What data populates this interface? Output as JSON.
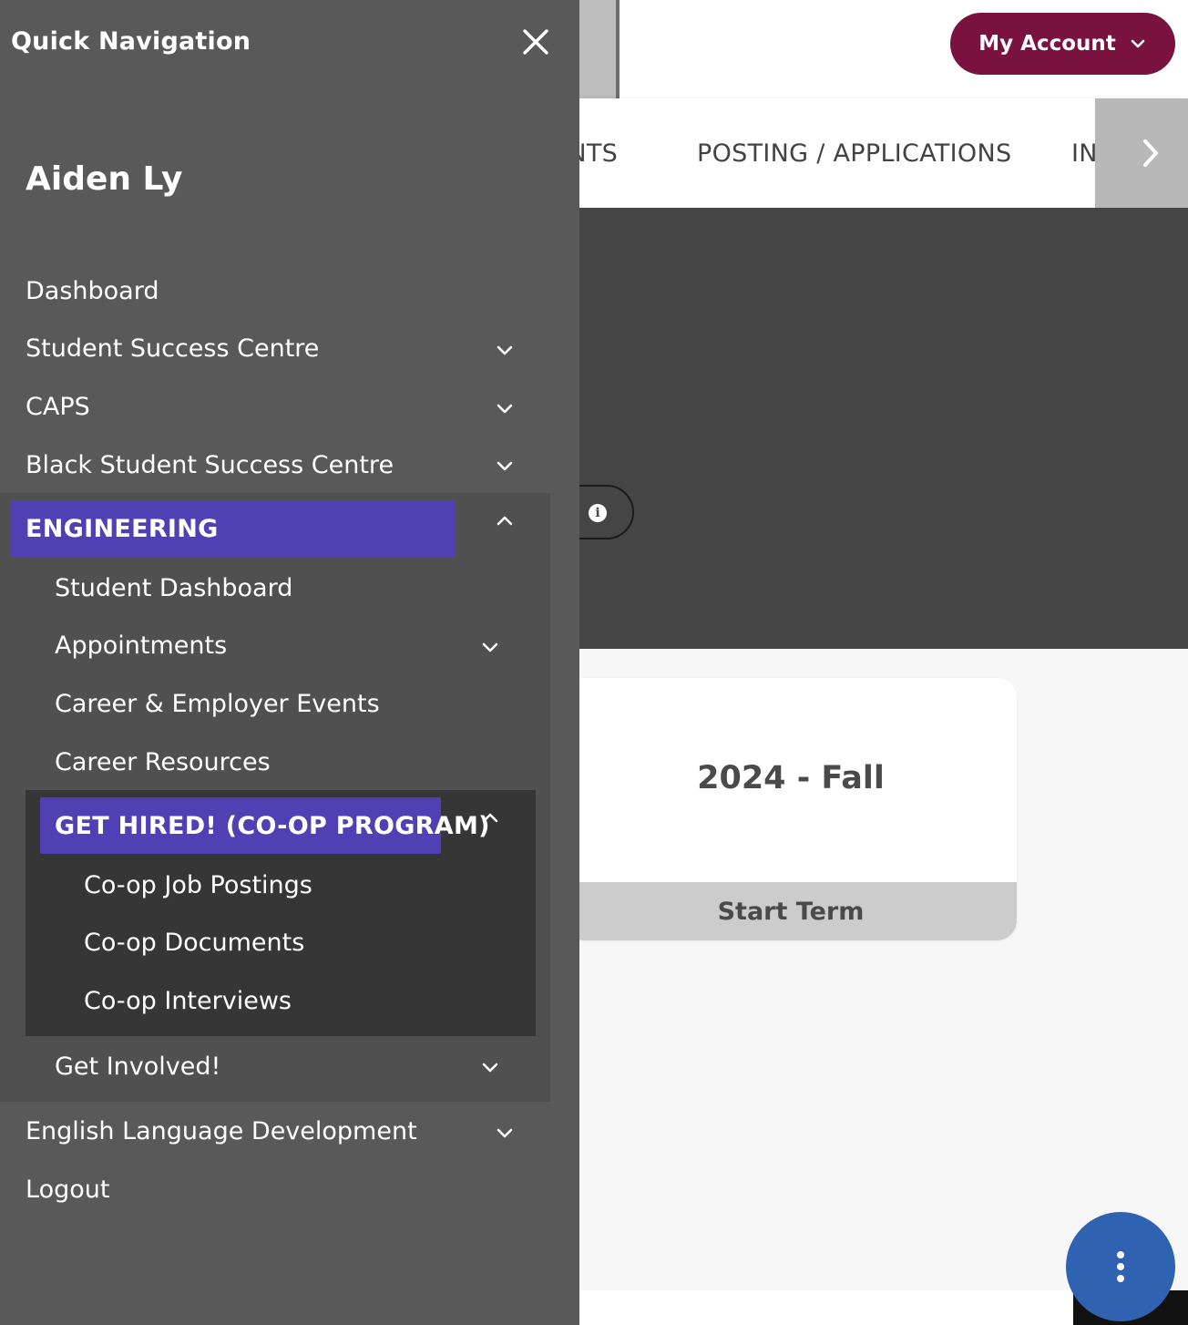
{
  "header": {
    "account_label": "My Account"
  },
  "tabs": {
    "items": [
      {
        "label": "ENTS"
      },
      {
        "label": "POSTING / APPLICATIONS"
      },
      {
        "label": "INTER"
      }
    ]
  },
  "term_card": {
    "title": "2024 - Fall",
    "button_label": "Start Term"
  },
  "drawer": {
    "title": "Quick Navigation",
    "user_name": "Aiden Ly",
    "items": {
      "dashboard": "Dashboard",
      "student_success": "Student Success Centre",
      "caps": "CAPS",
      "black_student": "Black Student Success Centre",
      "engineering": "ENGINEERING",
      "student_dashboard": "Student Dashboard",
      "appointments": "Appointments",
      "career_events": "Career & Employer Events",
      "career_resources": "Career Resources",
      "get_hired": "GET HIRED! (CO-OP PROGRAM)",
      "coop_jobs": "Co-op Job Postings",
      "coop_documents": "Co-op Documents",
      "coop_interviews": "Co-op Interviews",
      "get_involved": "Get Involved!",
      "english_language": "English Language Development",
      "logout": "Logout"
    }
  },
  "colors": {
    "drawer_bg": "#595959",
    "active_item": "#5040b4",
    "account_button": "#7a1240",
    "fab": "#2f62b0"
  }
}
